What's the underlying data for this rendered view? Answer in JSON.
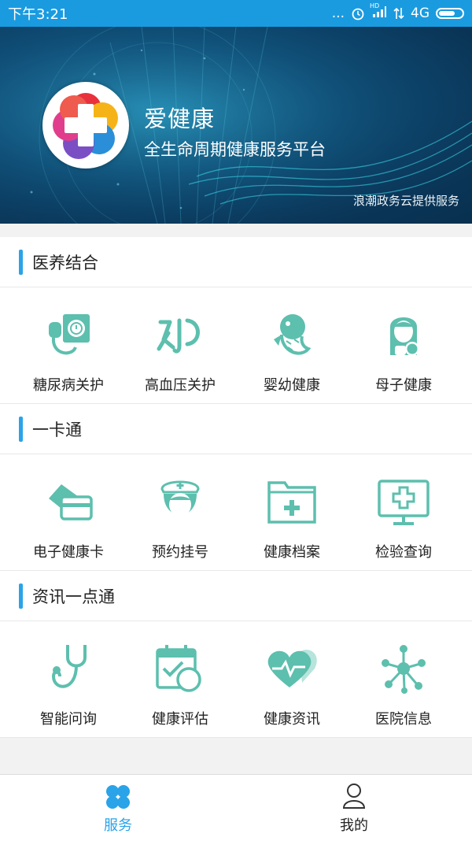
{
  "status_bar": {
    "time": "下午3:21",
    "dots": "...",
    "network": "4G",
    "signal_tag": "HD"
  },
  "banner": {
    "app_name": "爱健康",
    "slogan": "全生命周期健康服务平台",
    "provider": "浪潮政务云提供服务"
  },
  "sections": [
    {
      "title": "医养结合",
      "items": [
        {
          "label": "糖尿病关护",
          "icon": "blood-pressure-meter-icon"
        },
        {
          "label": "高血压关护",
          "icon": "hypertension-icon"
        },
        {
          "label": "婴幼健康",
          "icon": "fish-icon"
        },
        {
          "label": "母子健康",
          "icon": "mother-child-icon"
        }
      ]
    },
    {
      "title": "一卡通",
      "items": [
        {
          "label": "电子健康卡",
          "icon": "health-card-icon"
        },
        {
          "label": "预约挂号",
          "icon": "nurse-icon"
        },
        {
          "label": "健康档案",
          "icon": "medical-folder-icon"
        },
        {
          "label": "检验查询",
          "icon": "medical-monitor-icon"
        }
      ]
    },
    {
      "title": "资讯一点通",
      "items": [
        {
          "label": "智能问询",
          "icon": "stethoscope-icon"
        },
        {
          "label": "健康评估",
          "icon": "calendar-check-icon"
        },
        {
          "label": "健康资讯",
          "icon": "heartbeat-icon"
        },
        {
          "label": "医院信息",
          "icon": "network-icon"
        }
      ]
    }
  ],
  "tabbar": {
    "tabs": [
      {
        "label": "服务",
        "icon": "clover-icon",
        "active": true
      },
      {
        "label": "我的",
        "icon": "user-icon",
        "active": false
      }
    ]
  },
  "colors": {
    "status_bar": "#1a9be0",
    "accent": "#2aa3e8",
    "icon_teal": "#5dbfae",
    "tab_active": "#2aa3e8"
  }
}
